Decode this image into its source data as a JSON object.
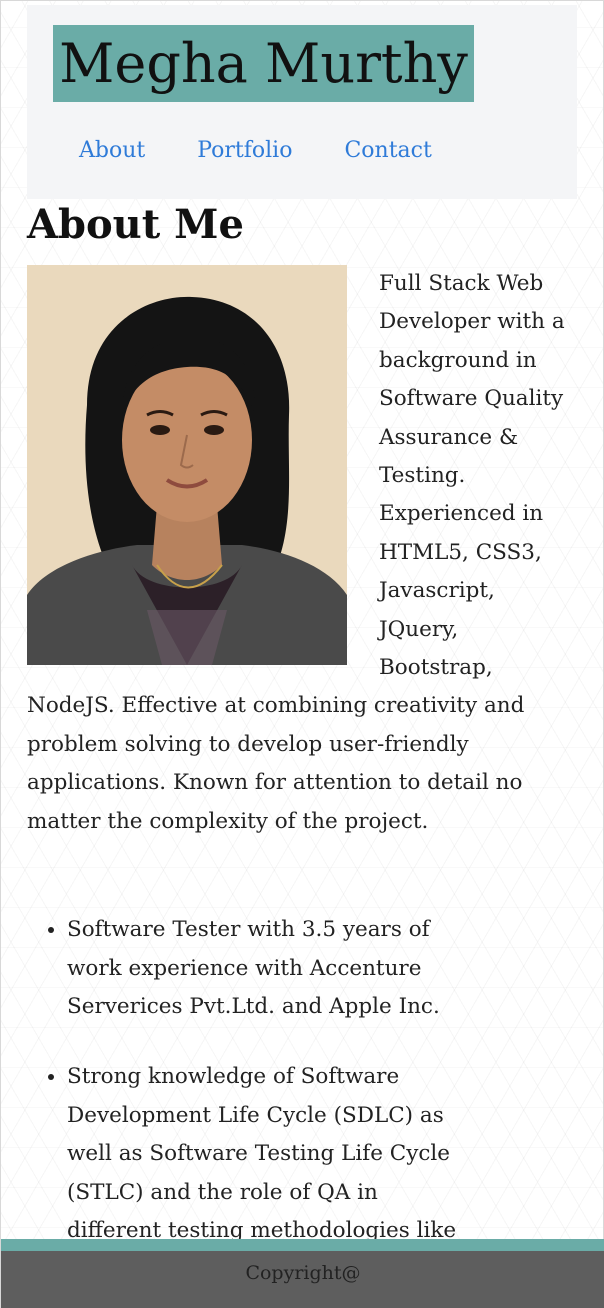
{
  "header": {
    "brand": "Megha Murthy",
    "nav": [
      "About",
      "Portfolio",
      "Contact"
    ]
  },
  "about": {
    "title": "About Me",
    "photo_alt": "profile-photo",
    "intro": "Full Stack Web Developer with a background in Software Quality Assurance & Testing. Experienced in HTML5, CSS3, Javascript, JQuery, Bootstrap, NodeJS. Effective at combining creativity and problem solving to develop user-friendly applications. Known for attention to detail no matter the complexity of the project.",
    "skills": [
      "Software Tester with 3.5 years of work experience with Accenture Serverices Pvt.Ltd. and Apple Inc.",
      "Strong knowledge of Software Development Life Cycle (SDLC) as well as Software Testing Life Cycle (STLC) and the role of QA in different testing methodologies like"
    ]
  },
  "footer": {
    "text": "Copyright@"
  },
  "colors": {
    "accent": "#6aaca7",
    "link": "#2f7bd8",
    "footer": "#5e5e5e"
  }
}
